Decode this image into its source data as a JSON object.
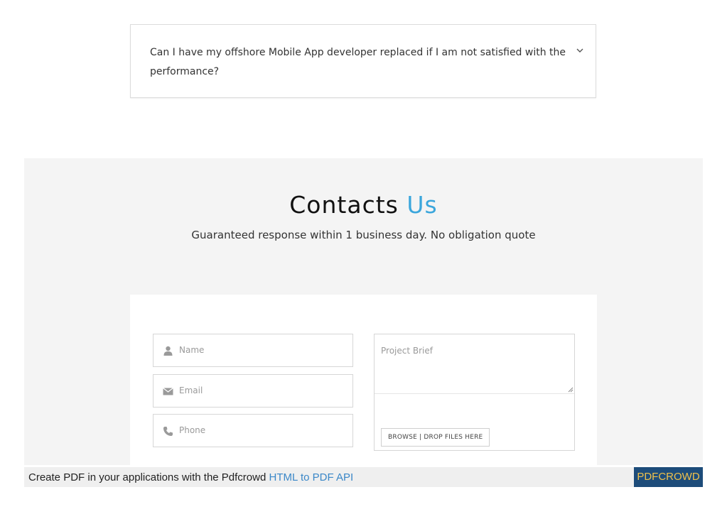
{
  "faq": {
    "question": "Can I have my offshore Mobile App developer replaced if I am not satisfied with the performance?",
    "toggle_icon": "chevron-down-icon"
  },
  "contact": {
    "title_main": "Contacts",
    "title_accent": "Us",
    "subtitle": "Guaranteed response within 1 business day. No obligation quote",
    "accent_color": "#3ba6dc",
    "form": {
      "name_placeholder": "Name",
      "email_placeholder": "Email",
      "phone_placeholder": "Phone",
      "brief_placeholder": "Project Brief",
      "browse_label": "BROWSE | DROP FILES HERE"
    }
  },
  "pdfcrowd": {
    "text": "Create PDF in your applications with the Pdfcrowd",
    "link": "HTML to PDF API",
    "badge": "PDFCROWD"
  }
}
